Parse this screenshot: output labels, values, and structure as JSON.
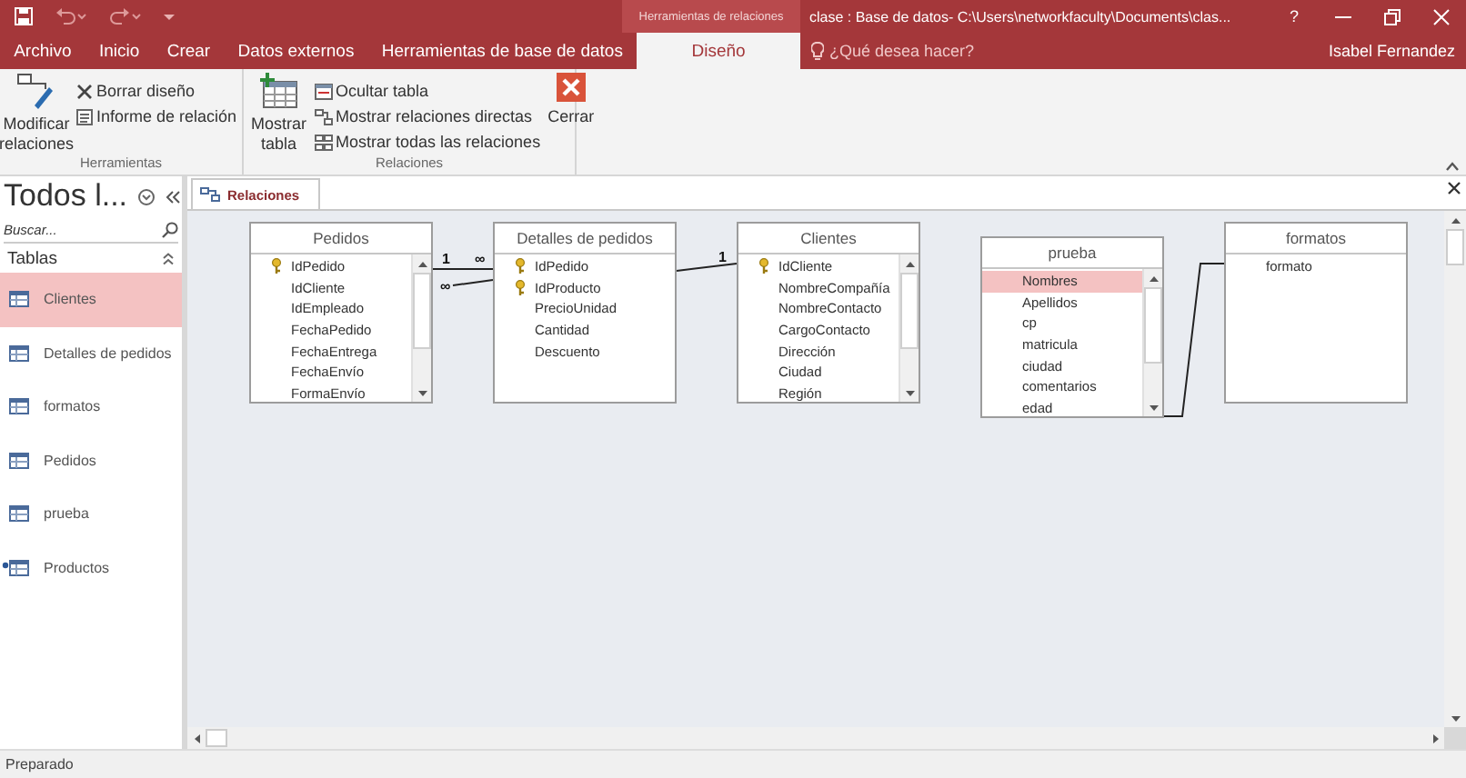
{
  "window": {
    "context_group": "Herramientas de relaciones",
    "title": "clase : Base de datos- C:\\Users\\networkfaculty\\Documents\\clas...",
    "help": "?"
  },
  "ribbon_tabs": [
    {
      "label": "Archivo",
      "selected": false
    },
    {
      "label": "Inicio",
      "selected": false
    },
    {
      "label": "Crear",
      "selected": false
    },
    {
      "label": "Datos externos",
      "selected": false
    },
    {
      "label": "Herramientas de base de datos",
      "selected": false
    },
    {
      "label": "Diseño",
      "selected": true
    }
  ],
  "tell_me": {
    "placeholder": "¿Qué desea hacer?"
  },
  "user": "Isabel Fernandez",
  "ribbon_groups": [
    {
      "label": "Herramientas",
      "commands": [
        {
          "label": "Modificar relaciones",
          "kind": "large"
        },
        {
          "label": "Borrar diseño",
          "kind": "small"
        },
        {
          "label": "Informe de relación",
          "kind": "small"
        }
      ]
    },
    {
      "label": "Relaciones",
      "commands": [
        {
          "label": "Mostrar tabla",
          "kind": "large"
        },
        {
          "label": "Ocultar tabla",
          "kind": "small"
        },
        {
          "label": "Mostrar relaciones directas",
          "kind": "small"
        },
        {
          "label": "Mostrar todas las relaciones",
          "kind": "small"
        },
        {
          "label": "Cerrar",
          "kind": "large"
        }
      ]
    }
  ],
  "nav_pane": {
    "title": "Todos l...",
    "search": {
      "placeholder": "Buscar..."
    },
    "section": "Tablas",
    "items": [
      {
        "label": "Clientes",
        "selected": true,
        "flagged": false
      },
      {
        "label": "Detalles de pedidos",
        "selected": false,
        "flagged": false
      },
      {
        "label": "formatos",
        "selected": false,
        "flagged": false
      },
      {
        "label": "Pedidos",
        "selected": false,
        "flagged": false
      },
      {
        "label": "prueba",
        "selected": false,
        "flagged": false
      },
      {
        "label": "Productos",
        "selected": false,
        "flagged": true
      }
    ]
  },
  "document_tabs": [
    {
      "label": "Relaciones",
      "selected": true
    }
  ],
  "tables": [
    {
      "title": "Pedidos",
      "scrollable": true,
      "fields": [
        {
          "name": "IdPedido",
          "key": true,
          "selected": false
        },
        {
          "name": "IdCliente",
          "key": false,
          "selected": false
        },
        {
          "name": "IdEmpleado",
          "key": false,
          "selected": false
        },
        {
          "name": "FechaPedido",
          "key": false,
          "selected": false
        },
        {
          "name": "FechaEntrega",
          "key": false,
          "selected": false
        },
        {
          "name": "FechaEnvío",
          "key": false,
          "selected": false
        },
        {
          "name": "FormaEnvío",
          "key": false,
          "selected": false
        }
      ]
    },
    {
      "title": "Detalles de pedidos",
      "scrollable": false,
      "fields": [
        {
          "name": "IdPedido",
          "key": true,
          "selected": false
        },
        {
          "name": "IdProducto",
          "key": true,
          "selected": false
        },
        {
          "name": "PrecioUnidad",
          "key": false,
          "selected": false
        },
        {
          "name": "Cantidad",
          "key": false,
          "selected": false
        },
        {
          "name": "Descuento",
          "key": false,
          "selected": false
        }
      ]
    },
    {
      "title": "Clientes",
      "scrollable": true,
      "fields": [
        {
          "name": "IdCliente",
          "key": true,
          "selected": false
        },
        {
          "name": "NombreCompañía",
          "key": false,
          "selected": false
        },
        {
          "name": "NombreContacto",
          "key": false,
          "selected": false
        },
        {
          "name": "CargoContacto",
          "key": false,
          "selected": false
        },
        {
          "name": "Dirección",
          "key": false,
          "selected": false
        },
        {
          "name": "Ciudad",
          "key": false,
          "selected": false
        },
        {
          "name": "Región",
          "key": false,
          "selected": false
        }
      ]
    },
    {
      "title": "prueba",
      "scrollable": true,
      "fields": [
        {
          "name": "Nombres",
          "key": false,
          "selected": true
        },
        {
          "name": "Apellidos",
          "key": false,
          "selected": false
        },
        {
          "name": "cp",
          "key": false,
          "selected": false
        },
        {
          "name": "matricula",
          "key": false,
          "selected": false
        },
        {
          "name": "ciudad",
          "key": false,
          "selected": false
        },
        {
          "name": "comentarios",
          "key": false,
          "selected": false
        },
        {
          "name": "edad",
          "key": false,
          "selected": false
        }
      ]
    },
    {
      "title": "formatos",
      "scrollable": false,
      "fields": [
        {
          "name": "formato",
          "key": false,
          "selected": false
        }
      ]
    }
  ],
  "relation_marks": [
    "1",
    "∞",
    "1",
    "∞"
  ],
  "status_bar": "Preparado"
}
